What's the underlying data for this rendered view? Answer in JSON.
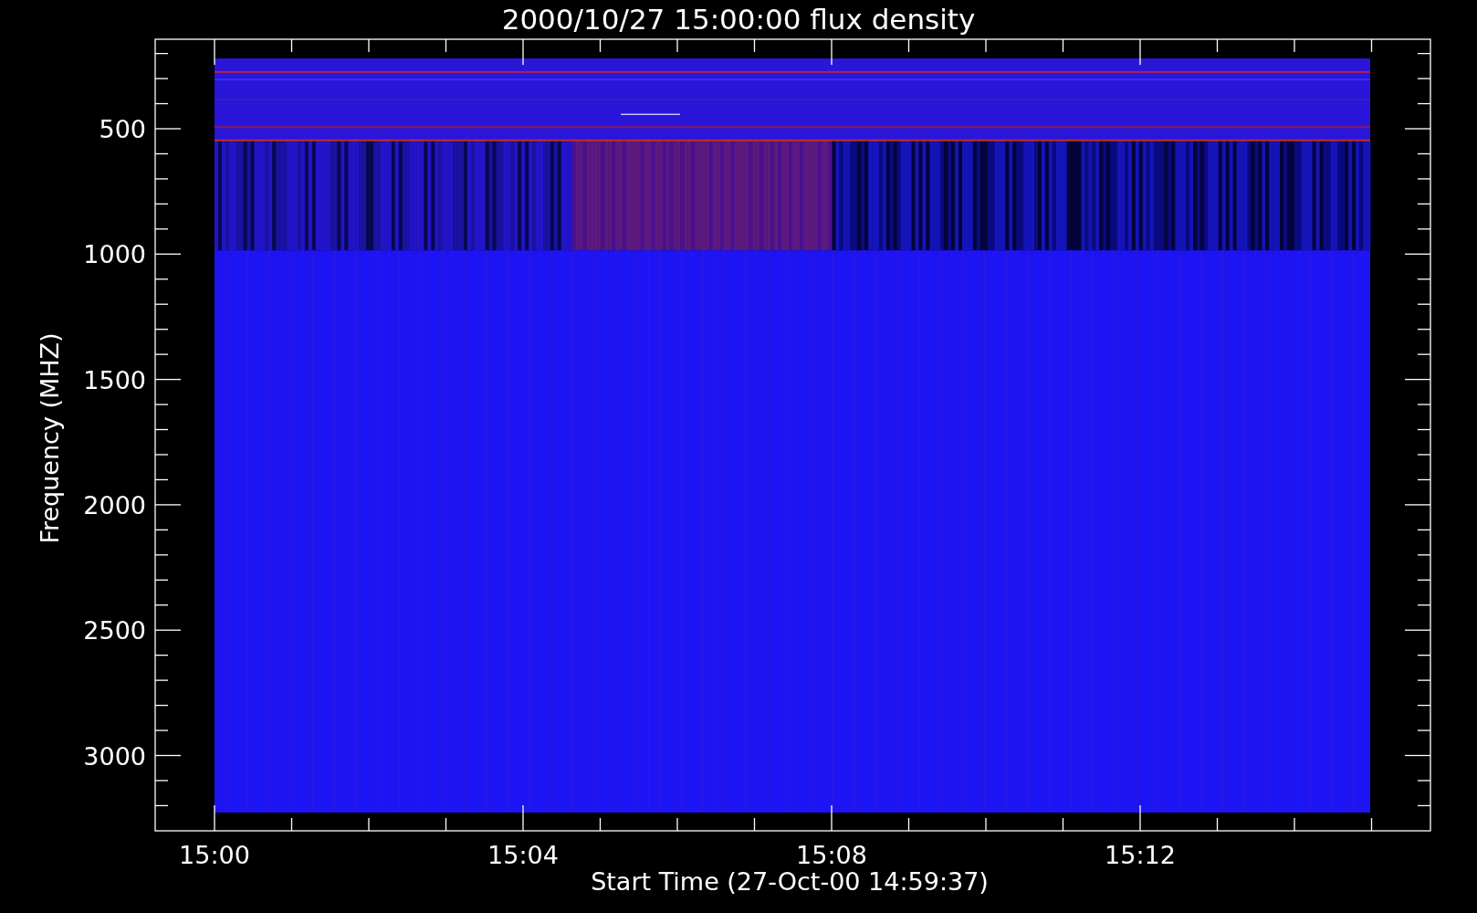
{
  "title": "2000/10/27 15:00:00 flux density",
  "y_axis": {
    "label": "Frequency (MHZ)",
    "ticks": [
      "500",
      "1000",
      "1500",
      "2000",
      "2500",
      "3000"
    ]
  },
  "x_axis": {
    "label": "Start Time (27-Oct-00 14:59:37)",
    "ticks": [
      "15:00",
      "15:04",
      "15:08",
      "15:12"
    ]
  }
}
